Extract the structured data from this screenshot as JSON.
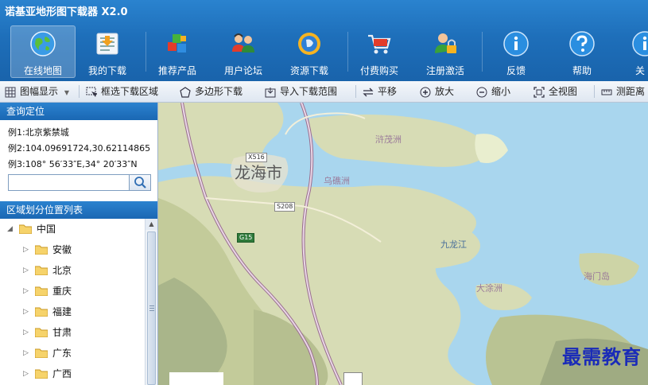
{
  "app": {
    "title": "诺基亚地形图下载器 X2.0"
  },
  "nav": [
    {
      "label": "在线地图",
      "icon": "globe-icon",
      "active": true
    },
    {
      "label": "我的下载",
      "icon": "download-list-icon"
    },
    {
      "label": "推荐产品",
      "icon": "blocks-icon"
    },
    {
      "label": "用户论坛",
      "icon": "users-icon"
    },
    {
      "label": "资源下载",
      "icon": "resource-download-icon"
    },
    {
      "label": "付费购买",
      "icon": "cart-icon"
    },
    {
      "label": "注册激活",
      "icon": "register-lock-icon"
    },
    {
      "label": "反馈",
      "icon": "info-icon"
    },
    {
      "label": "帮助",
      "icon": "help-icon"
    },
    {
      "label": "关",
      "icon": "info-icon"
    }
  ],
  "toolbar": {
    "layer_display": "图幅显示",
    "box_select": "框选下载区域",
    "polygon": "多边形下载",
    "import_range": "导入下载范围",
    "pan": "平移",
    "zoom_in": "放大",
    "zoom_out": "缩小",
    "full_view": "全视图",
    "measure": "测距离"
  },
  "query": {
    "header": "查询定位",
    "example1": "例1:北京紫禁城",
    "example2": "例2:104.09691724,30.62114865",
    "example3": "例3:108° 56′33″E,34° 20′33″N",
    "search_value": ""
  },
  "region": {
    "header": "区域划分位置列表",
    "root": "中国",
    "children": [
      "安徽",
      "北京",
      "重庆",
      "福建",
      "甘肃",
      "广东",
      "广西"
    ]
  },
  "map": {
    "city": "龙海市",
    "labels": [
      "浒茂洲",
      "乌礁洲",
      "九龙江",
      "大涂洲",
      "海门岛"
    ],
    "shields": [
      "X516",
      "S208",
      "G15"
    ]
  },
  "watermark": "最需教育"
}
